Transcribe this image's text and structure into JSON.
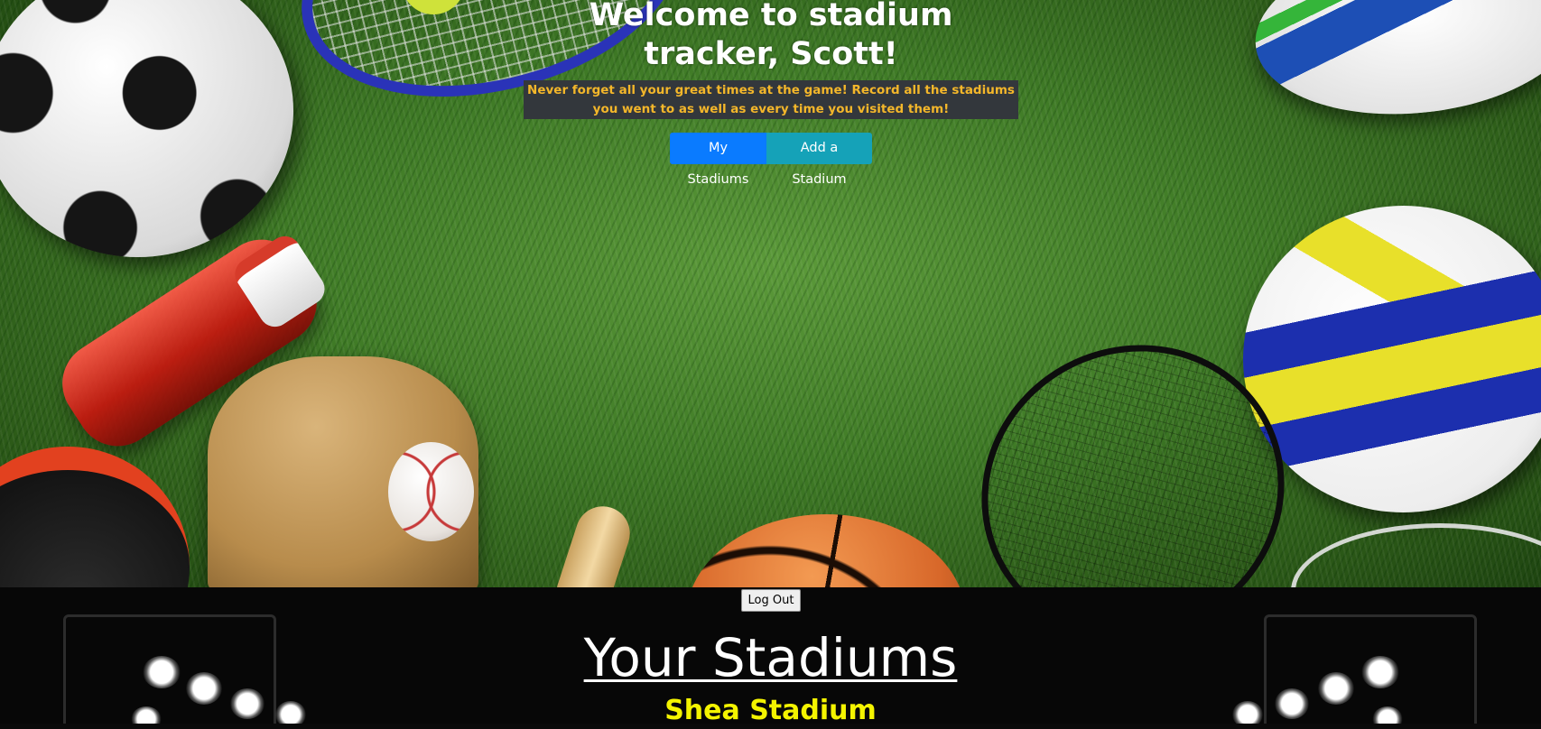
{
  "hero": {
    "title": "Welcome to stadium tracker, Scott!",
    "subtitle": "Never forget all your great times at the game! Record all the stadiums you went to as well as every time you visited them!",
    "buttons": {
      "my_stadiums": "My Stadiums",
      "add_stadium": "Add a Stadium"
    }
  },
  "logout_label": "Log Out",
  "stadiums_section": {
    "heading": "Your Stadiums",
    "items": [
      {
        "name": "Shea Stadium"
      }
    ]
  },
  "colors": {
    "subtitle_text": "#f4b72a",
    "subtitle_bg": "#33373c",
    "primary_button": "#0a7bff",
    "info_button": "#15a2b8",
    "stadium_name": "#f4f400"
  }
}
